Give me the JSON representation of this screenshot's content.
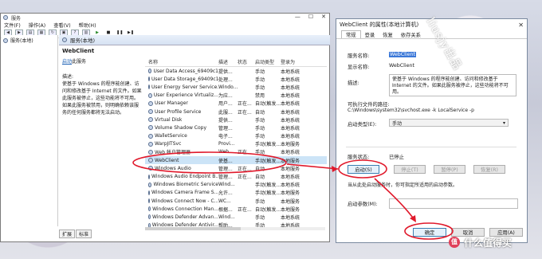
{
  "services_window": {
    "title": "服务",
    "controls": [
      "—",
      "☐",
      "✕"
    ],
    "menu": [
      "文件(F)",
      "操作(A)",
      "查看(V)",
      "帮助(H)"
    ],
    "tree_root": "服务(本地)",
    "panel_title": "服务(本地)",
    "selected_service": "WebClient",
    "action_link": "启动",
    "action_suffix": "此服务",
    "description_label": "描述:",
    "description_text": "使基于 Windows 的程序能创建、访问和修改基于 Internet 的文件。如果此服务被停止，这些功能将不可用。如果此服务被禁用，则明确依赖该服务的任何服务都将无法启动。",
    "columns": [
      "名称",
      "描述",
      "状态",
      "启动类型",
      "登录为"
    ],
    "rows": [
      {
        "name": "User Data Access_69409c1",
        "desc": "提供...",
        "status": "",
        "startup": "手动",
        "logon": "本地系统"
      },
      {
        "name": "User Data Storage_69409c1",
        "desc": "处理...",
        "status": "",
        "startup": "手动",
        "logon": "本地系统"
      },
      {
        "name": "User Energy Server Service...",
        "desc": "Windo...",
        "status": "",
        "startup": "手动",
        "logon": "本地系统"
      },
      {
        "name": "User Experience Virtualiz...",
        "desc": "为应...",
        "status": "",
        "startup": "禁用",
        "logon": "本地系统"
      },
      {
        "name": "User Manager",
        "desc": "用户...",
        "status": "正在...",
        "startup": "自动(触发...",
        "logon": "本地系统"
      },
      {
        "name": "User Profile Service",
        "desc": "此服...",
        "status": "正在...",
        "startup": "自动",
        "logon": "本地系统"
      },
      {
        "name": "Virtual Disk",
        "desc": "提供...",
        "status": "",
        "startup": "手动",
        "logon": "本地系统"
      },
      {
        "name": "Volume Shadow Copy",
        "desc": "管理...",
        "status": "",
        "startup": "手动",
        "logon": "本地系统"
      },
      {
        "name": "WalletService",
        "desc": "电子...",
        "status": "",
        "startup": "手动",
        "logon": "本地系统"
      },
      {
        "name": "WarpJITSvc",
        "desc": "Provi...",
        "status": "",
        "startup": "手动(触发...",
        "logon": "本地服务"
      },
      {
        "name": "Web 帐户管理器",
        "desc": "Web...",
        "status": "正在...",
        "startup": "手动",
        "logon": "本地系统"
      },
      {
        "name": "WebClient",
        "desc": "使基...",
        "status": "",
        "startup": "手动(触发...",
        "logon": "本地服务"
      },
      {
        "name": "Windows Audio",
        "desc": "管理...",
        "status": "正在...",
        "startup": "自动",
        "logon": "本地服务"
      },
      {
        "name": "Windows Audio Endpoint B...",
        "desc": "管理...",
        "status": "正在...",
        "startup": "自动",
        "logon": "本地系统"
      },
      {
        "name": "Windows Biometric Service",
        "desc": "Wind...",
        "status": "",
        "startup": "手动(触发...",
        "logon": "本地系统"
      },
      {
        "name": "Windows Camera Frame S...",
        "desc": "允许...",
        "status": "",
        "startup": "手动(触发...",
        "logon": "本地服务"
      },
      {
        "name": "Windows Connect Now - C...",
        "desc": "WC...",
        "status": "",
        "startup": "手动",
        "logon": "本地服务"
      },
      {
        "name": "Windows Connection Man...",
        "desc": "根据...",
        "status": "正在...",
        "startup": "自动(触发...",
        "logon": "本地服务"
      },
      {
        "name": "Windows Defender Advan...",
        "desc": "Wind...",
        "status": "",
        "startup": "手动",
        "logon": "本地系统"
      },
      {
        "name": "Windows Defender Antivir...",
        "desc": "帮助...",
        "status": "",
        "startup": "手动",
        "logon": "本地系统"
      }
    ],
    "bottom_tabs": [
      "扩展",
      "标准"
    ]
  },
  "properties_dialog": {
    "title": "WebClient 的属性(本地计算机)",
    "close": "✕",
    "tabs": [
      "常规",
      "登录",
      "恢复",
      "依存关系"
    ],
    "service_name_label": "服务名称:",
    "service_name": "WebClient",
    "display_name_label": "显示名称:",
    "display_name": "WebClient",
    "description_label": "描述:",
    "description": "使基于 Windows 的程序能创建、访问和修改基于 Internet 的文件。如果此服务被停止，这些功能将不可用。",
    "exe_path_label": "可执行文件的路径:",
    "exe_path": "C:\\Windows\\system32\\svchost.exe -k LocalService -p",
    "startup_type_label": "启动类型(E):",
    "startup_type": "手动",
    "status_label": "服务状态:",
    "status": "已停止",
    "buttons": {
      "start": "启动(S)",
      "stop": "停止(T)",
      "pause": "暂停(P)",
      "resume": "恢复(R)"
    },
    "hint": "当从此处启动服务时，你可指定所适用的启动参数。",
    "params_label": "启动参数(M):",
    "ok": "确定",
    "cancel": "取消",
    "apply": "应用(A)"
  },
  "watermark": "liusjy出品",
  "brand": "什么值得买",
  "brand_logo": "值",
  "colors": {
    "selection": "#cce4f7",
    "annotation": "#e0192b",
    "highlight": "#3b78d8"
  }
}
